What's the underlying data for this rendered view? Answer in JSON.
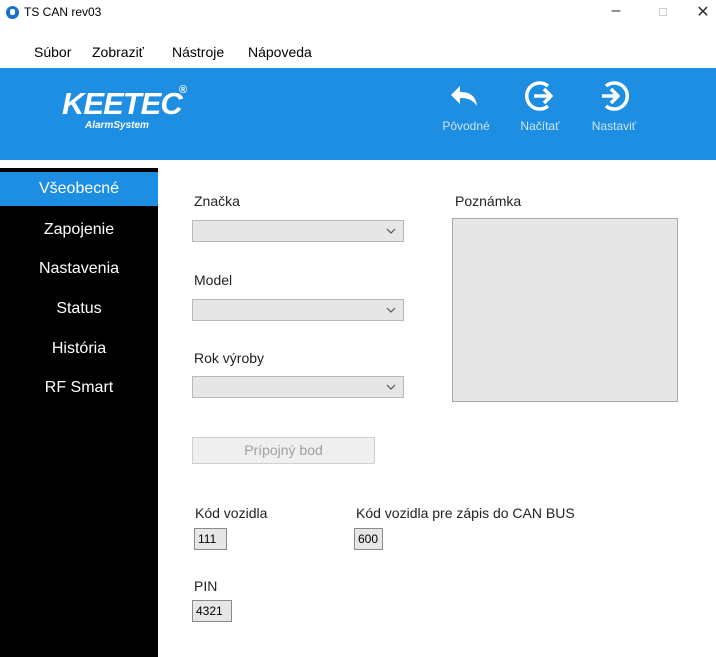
{
  "window": {
    "title": "TS CAN rev03",
    "minimize": "–",
    "maximize": "□",
    "close": "✕"
  },
  "menu": [
    "Súbor",
    "Zobraziť",
    "Nástroje",
    "Nápoveda"
  ],
  "brand": {
    "logo": "KEETEC",
    "reg": "®",
    "sub": "AlarmSystem",
    "color": "#1d8ee2"
  },
  "toolbar": [
    {
      "label": "Pôvodné",
      "icon": "undo-arrow-icon"
    },
    {
      "label": "Načítať",
      "icon": "import-arrow-icon"
    },
    {
      "label": "Nastaviť",
      "icon": "export-arrow-icon"
    }
  ],
  "sidebar": {
    "items": [
      "Všeobecné",
      "Zapojenie",
      "Nastavenia",
      "Status",
      "História",
      "RF Smart"
    ],
    "active": "Všeobecné"
  },
  "form": {
    "brand_label": "Značka",
    "brand_value": "",
    "model_label": "Model",
    "model_value": "",
    "year_label": "Rok výroby",
    "year_value": "",
    "note_label": "Poznámka",
    "note_value": "",
    "connection_button": "Prípojný bod",
    "vehicle_code_label": "Kód vozidla",
    "vehicle_code_value": "111",
    "canbus_code_label": "Kód vozidla pre zápis do CAN BUS",
    "canbus_code_value": "600",
    "pin_label": "PIN",
    "pin_value": "4321"
  }
}
